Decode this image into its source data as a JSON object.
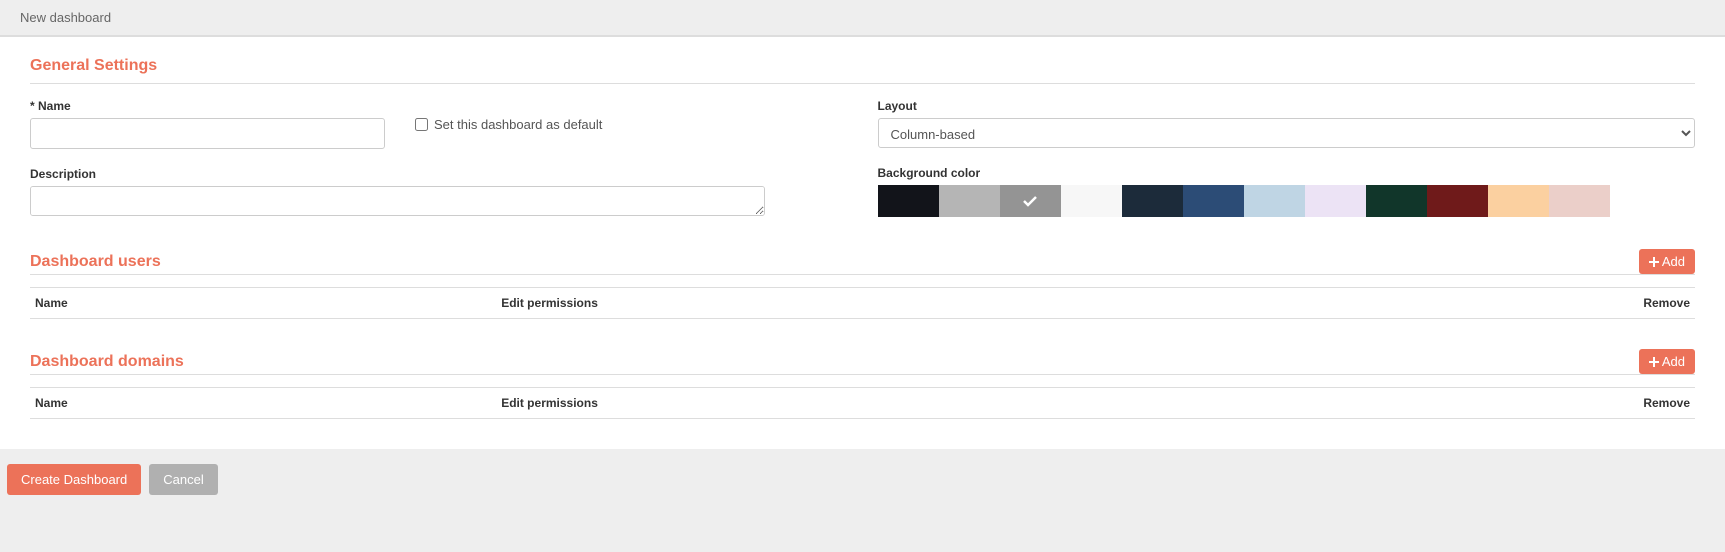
{
  "header": {
    "title": "New dashboard"
  },
  "general": {
    "section_title": "General Settings",
    "name_label": "* Name",
    "name_value": "",
    "default_checkbox_label": "Set this dashboard as default",
    "default_checked": false,
    "description_label": "Description",
    "description_value": "",
    "layout_label": "Layout",
    "layout_value": "Column-based",
    "layout_options": [
      "Column-based"
    ],
    "bg_label": "Background color",
    "bg_colors": [
      {
        "hex": "#12141a",
        "selected": false
      },
      {
        "hex": "#b5b5b5",
        "selected": false
      },
      {
        "hex": "#949494",
        "selected": true
      },
      {
        "hex": "#f7f7f7",
        "selected": false
      },
      {
        "hex": "#1c2b3a",
        "selected": false
      },
      {
        "hex": "#2c4c76",
        "selected": false
      },
      {
        "hex": "#bfd5e4",
        "selected": false
      },
      {
        "hex": "#ece3f5",
        "selected": false
      },
      {
        "hex": "#11362a",
        "selected": false
      },
      {
        "hex": "#6f1a1a",
        "selected": false
      },
      {
        "hex": "#fbd0a0",
        "selected": false
      },
      {
        "hex": "#ebcfc9",
        "selected": false
      }
    ]
  },
  "users": {
    "section_title": "Dashboard users",
    "add_label": "Add",
    "columns": {
      "name": "Name",
      "edit": "Edit permissions",
      "remove": "Remove"
    }
  },
  "domains": {
    "section_title": "Dashboard domains",
    "add_label": "Add",
    "columns": {
      "name": "Name",
      "edit": "Edit permissions",
      "remove": "Remove"
    }
  },
  "footer": {
    "create_label": "Create Dashboard",
    "cancel_label": "Cancel"
  }
}
